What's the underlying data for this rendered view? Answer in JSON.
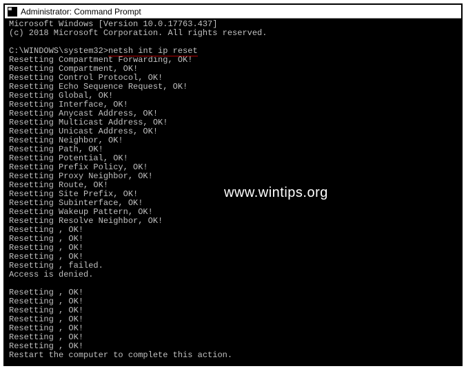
{
  "title_bar": {
    "icon_label": "CA",
    "title": "Administrator: Command Prompt"
  },
  "header": {
    "line1": "Microsoft Windows [Version 10.0.17763.437]",
    "line2": "(c) 2018 Microsoft Corporation. All rights reserved."
  },
  "prompt": "C:\\WINDOWS\\system32>",
  "command": "netsh int ip reset",
  "output": [
    "Resetting Compartment Forwarding, OK!",
    "Resetting Compartment, OK!",
    "Resetting Control Protocol, OK!",
    "Resetting Echo Sequence Request, OK!",
    "Resetting Global, OK!",
    "Resetting Interface, OK!",
    "Resetting Anycast Address, OK!",
    "Resetting Multicast Address, OK!",
    "Resetting Unicast Address, OK!",
    "Resetting Neighbor, OK!",
    "Resetting Path, OK!",
    "Resetting Potential, OK!",
    "Resetting Prefix Policy, OK!",
    "Resetting Proxy Neighbor, OK!",
    "Resetting Route, OK!",
    "Resetting Site Prefix, OK!",
    "Resetting Subinterface, OK!",
    "Resetting Wakeup Pattern, OK!",
    "Resetting Resolve Neighbor, OK!",
    "Resetting , OK!",
    "Resetting , OK!",
    "Resetting , OK!",
    "Resetting , OK!",
    "Resetting , failed.",
    "Access is denied.",
    "",
    "Resetting , OK!",
    "Resetting , OK!",
    "Resetting , OK!",
    "Resetting , OK!",
    "Resetting , OK!",
    "Resetting , OK!",
    "Resetting , OK!",
    "Restart the computer to complete this action."
  ],
  "watermark": "www.wintips.org"
}
